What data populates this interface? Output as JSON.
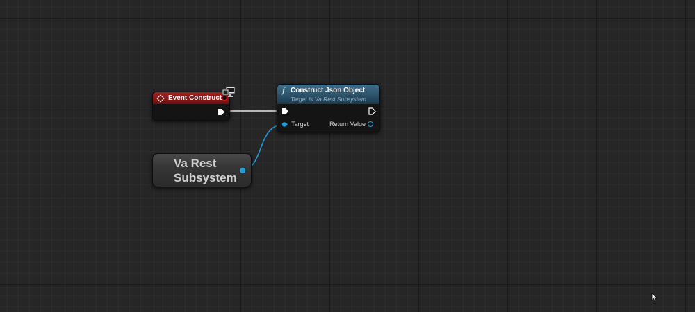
{
  "graph": {
    "background_color": "#262626"
  },
  "nodes": {
    "event_construct": {
      "title": "Event Construct",
      "header_color": "#a32020",
      "icon": "event-diamond-icon",
      "badge_icon": "monitor-icon"
    },
    "construct_json_object": {
      "title": "Construct Json Object",
      "subtitle": "Target is Va Rest Subsystem",
      "header_color": "#3f6f8c",
      "icon": "function-icon",
      "fn_symbol": "f",
      "pins": {
        "target_label": "Target",
        "return_label": "Return Value"
      }
    },
    "va_rest_subsystem": {
      "label": "Va Rest Subsystem",
      "pin_color": "#1f9ee0"
    }
  },
  "wires": {
    "exec_color": "#ffffff",
    "object_color": "#1f9ee0"
  }
}
